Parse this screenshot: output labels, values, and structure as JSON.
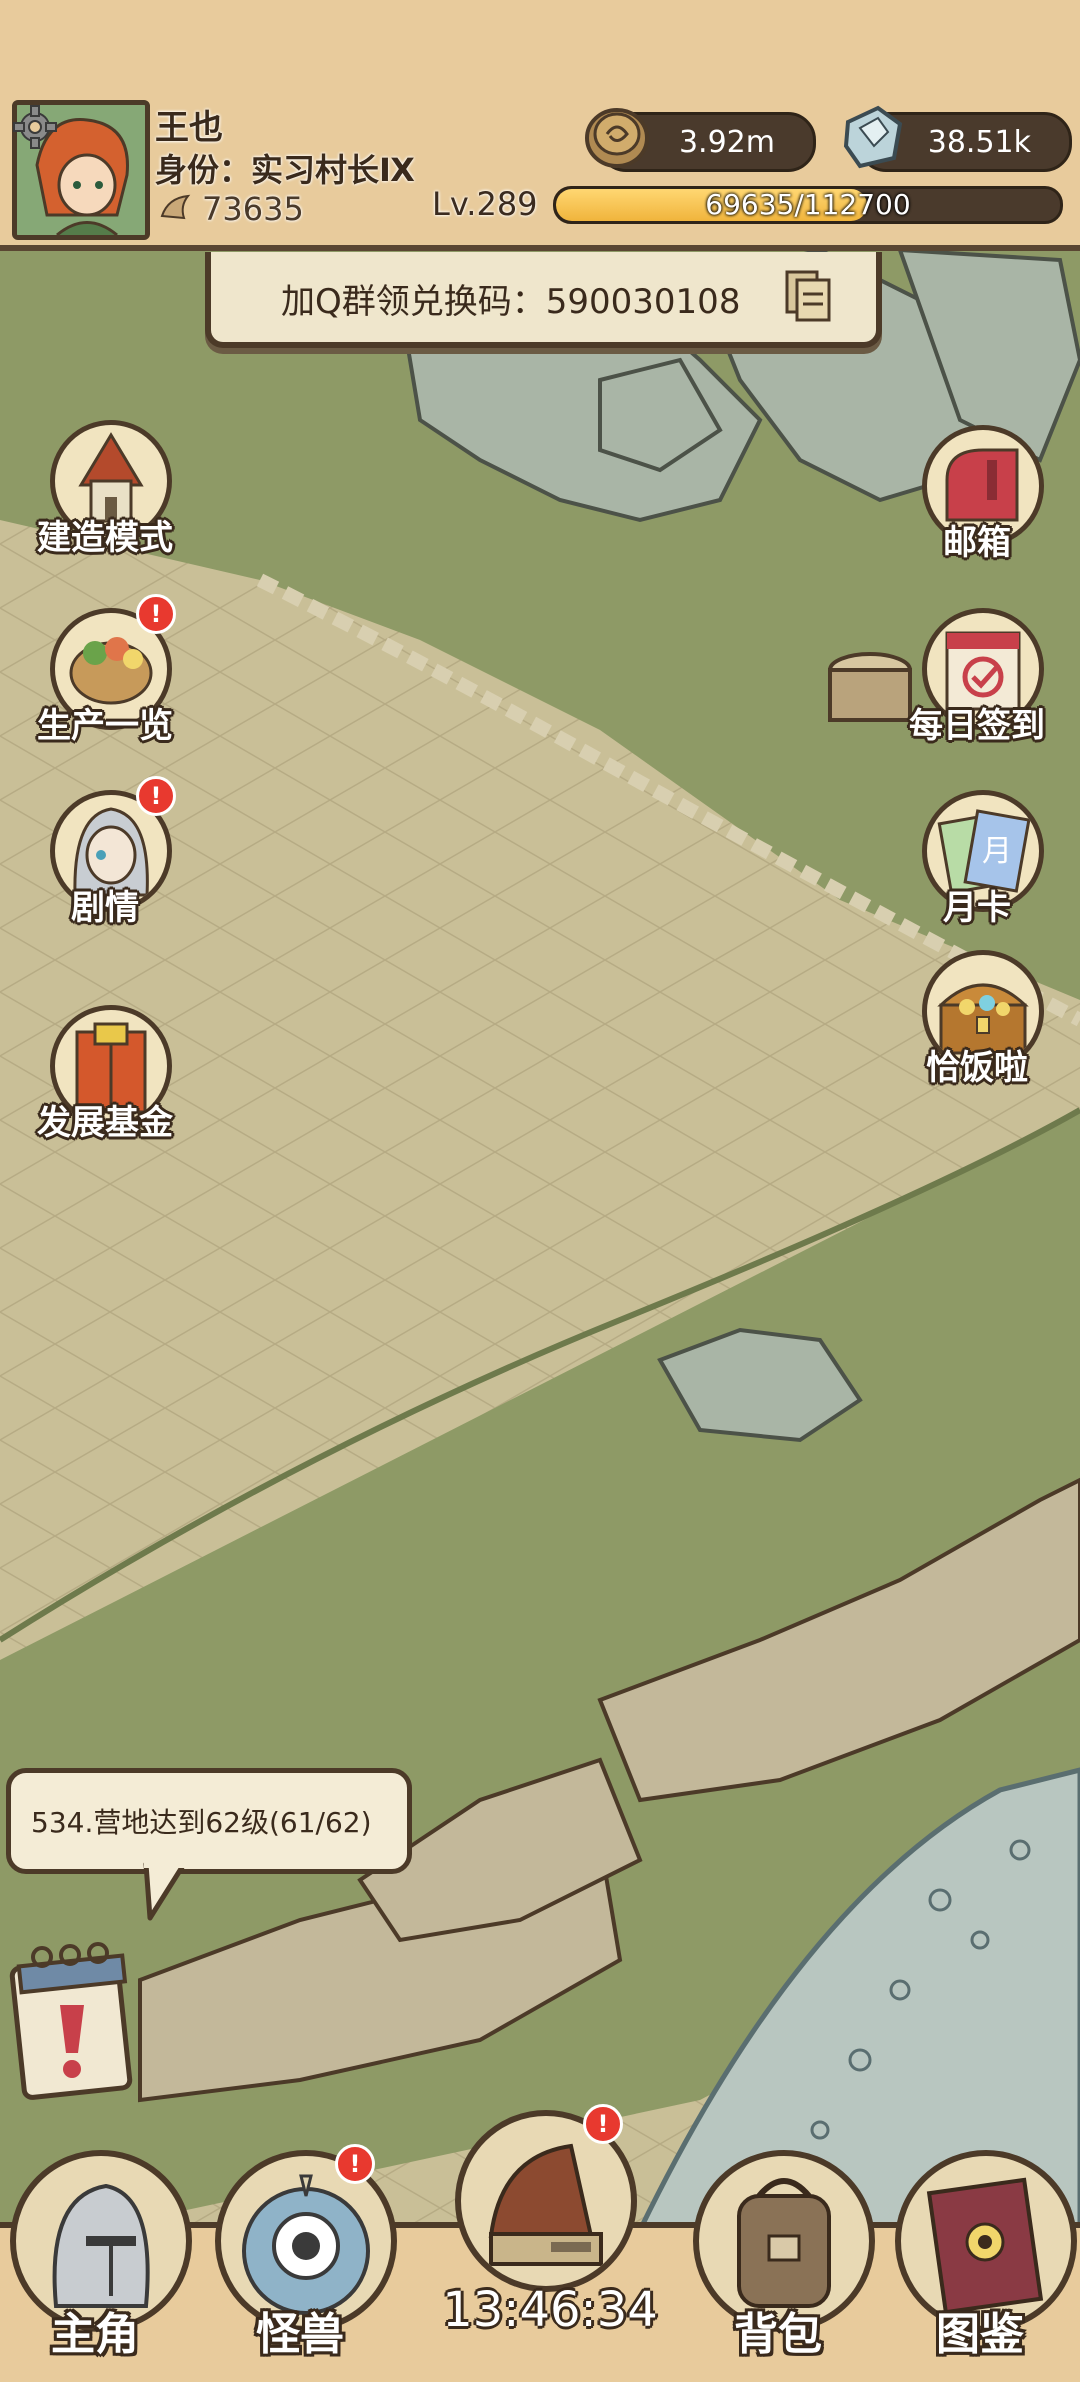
{
  "player": {
    "name": "王也",
    "title": "身份：实习村长Ⅸ",
    "power": "73635",
    "level": "Lv.289",
    "xp_text": "69635/112700",
    "xp_progress": 0.618
  },
  "currencies": {
    "coins": "3.92m",
    "gems": "38.51k"
  },
  "banner": {
    "text": "加Q群领兑换码：590030108"
  },
  "left_menu": [
    {
      "label": "建造模式",
      "icon": "build-mode-icon",
      "badge": false
    },
    {
      "label": "生产一览",
      "icon": "production-basket-icon",
      "badge": true
    },
    {
      "label": "剧情",
      "icon": "story-character-icon",
      "badge": true
    },
    {
      "label": "发展基金",
      "icon": "fund-book-icon",
      "badge": false
    }
  ],
  "right_menu": [
    {
      "label": "邮箱",
      "icon": "mailbox-icon"
    },
    {
      "label": "每日签到",
      "icon": "daily-checkin-icon"
    },
    {
      "label": "月卡",
      "icon": "monthly-card-icon"
    },
    {
      "label": "恰饭啦",
      "icon": "treasure-chest-icon"
    }
  ],
  "quest": {
    "text": "534.营地达到62级(61/62)"
  },
  "bottom_nav": [
    {
      "label": "主角",
      "icon": "knight-helmet-icon",
      "badge": false
    },
    {
      "label": "怪兽",
      "icon": "monster-eye-icon",
      "badge": true
    },
    {
      "label": "",
      "icon": "camp-tent-icon",
      "badge": true
    },
    {
      "label": "背包",
      "icon": "backpack-icon",
      "badge": false
    },
    {
      "label": "图鉴",
      "icon": "codex-book-icon",
      "badge": false
    }
  ],
  "clock": "13:46:34",
  "badge_mark": "!",
  "colors": {
    "hud_bg": "#e8cb9c",
    "grass": "#8e9a66",
    "path": "#c9bf97",
    "outline": "#4c3a28",
    "xp_fill": "#f0b43c",
    "badge_red": "#e8392f"
  }
}
